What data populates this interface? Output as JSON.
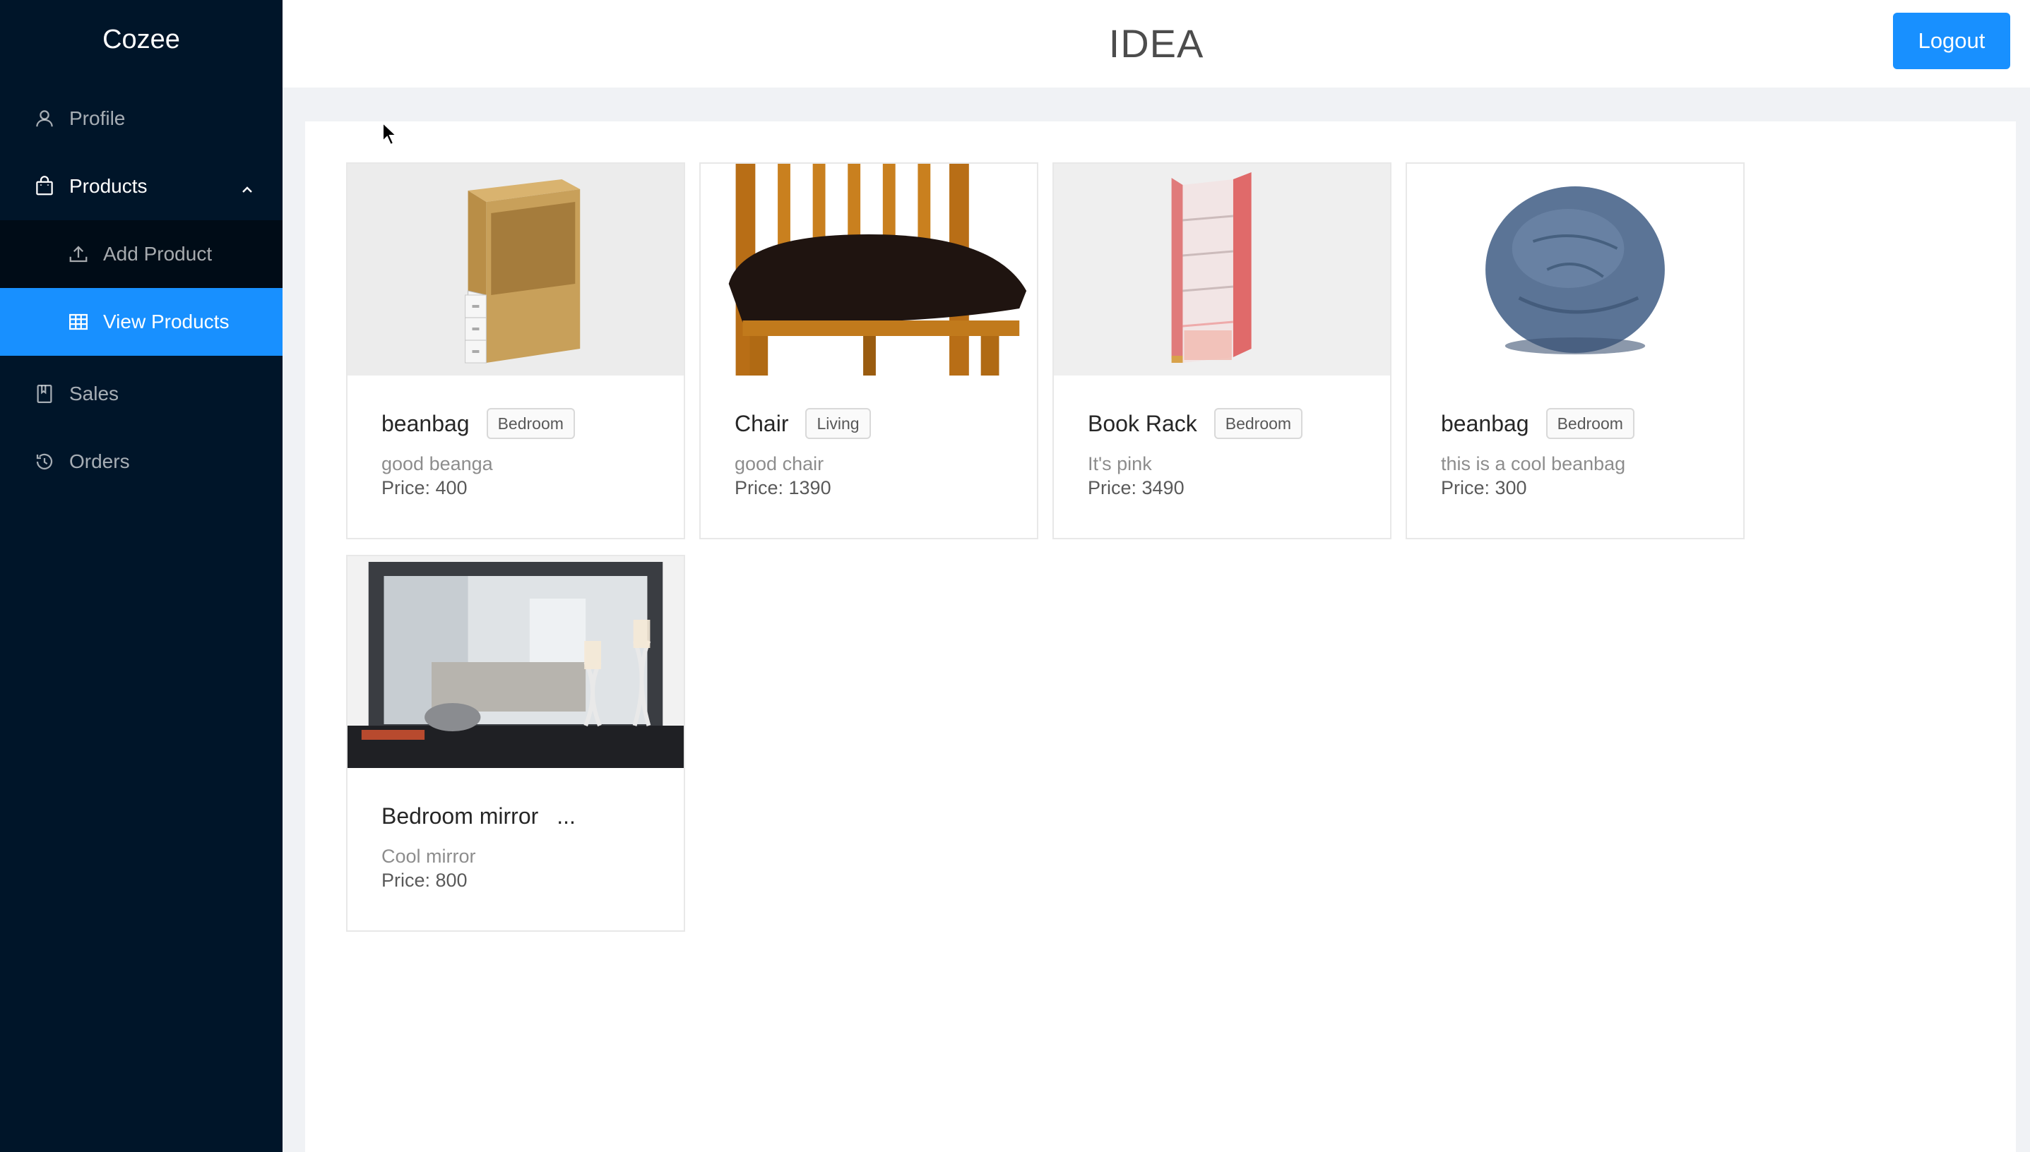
{
  "app": {
    "logo": "Cozee"
  },
  "sidebar": {
    "items": [
      {
        "label": "Profile",
        "icon": "user-icon"
      },
      {
        "label": "Products",
        "icon": "shopping-bag-icon",
        "expanded": true
      },
      {
        "label": "Sales",
        "icon": "book-icon"
      },
      {
        "label": "Orders",
        "icon": "history-icon"
      }
    ],
    "submenu": [
      {
        "label": "Add Product",
        "icon": "upload-icon"
      },
      {
        "label": "View Products",
        "icon": "table-icon",
        "selected": true
      }
    ]
  },
  "header": {
    "title": "IDEA",
    "logout_label": "Logout"
  },
  "products": [
    {
      "name": "beanbag",
      "tag": "Bedroom",
      "description": "good beanga",
      "price": "Price: 400",
      "image": "cabinet"
    },
    {
      "name": "Chair",
      "tag": "Living",
      "description": "good chair",
      "price": "Price: 1390",
      "image": "chair"
    },
    {
      "name": "Book Rack",
      "tag": "Bedroom",
      "description": "It's pink",
      "price": "Price: 3490",
      "image": "bookrack"
    },
    {
      "name": "beanbag",
      "tag": "Bedroom",
      "description": "this is a cool beanbag",
      "price": "Price: 300",
      "image": "beanbag"
    },
    {
      "name": "Bedroom mirror",
      "tag": "...",
      "description": "Cool mirror",
      "price": "Price: 800",
      "image": "mirror"
    }
  ],
  "colors": {
    "sidebar_bg": "#001529",
    "submenu_bg": "#000c17",
    "primary": "#1890ff",
    "page_bg": "#f0f2f5"
  }
}
